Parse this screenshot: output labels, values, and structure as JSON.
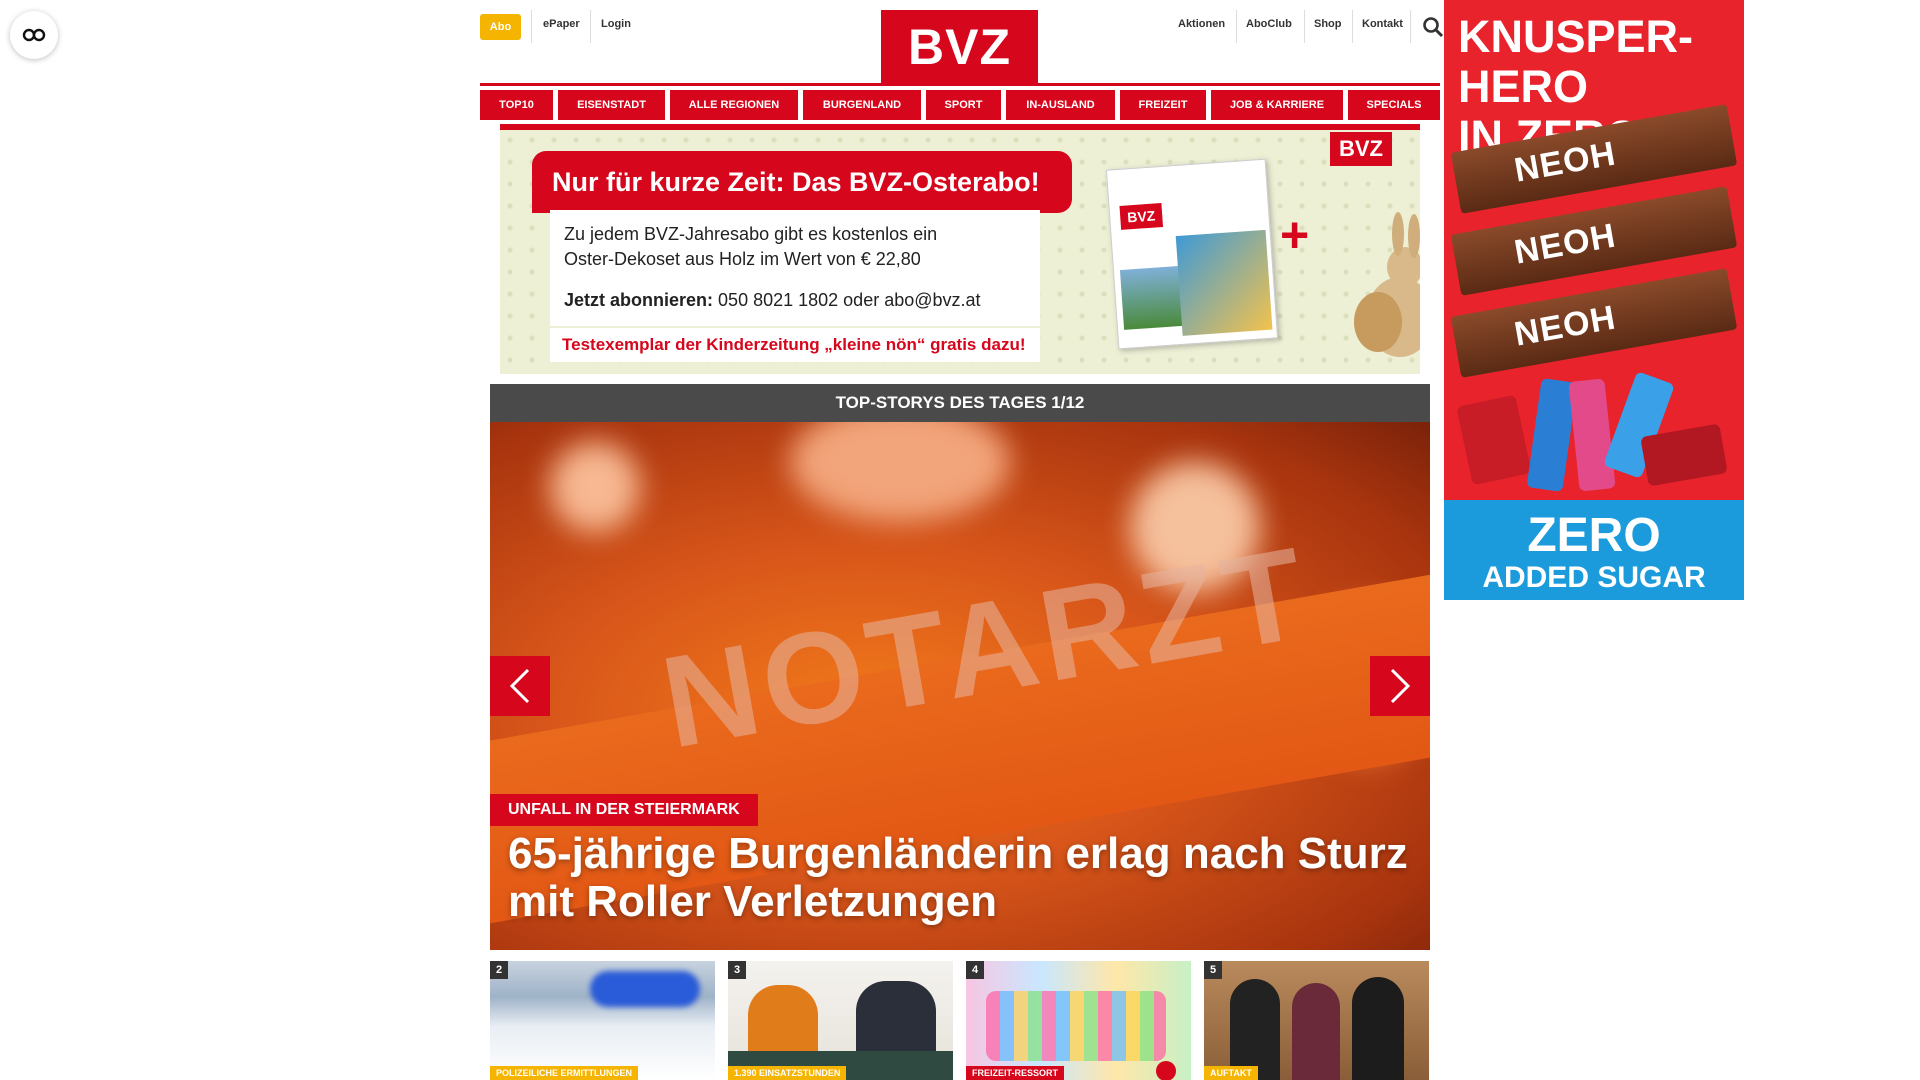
{
  "topbar": {
    "abo": "Abo",
    "epaper": "ePaper",
    "login": "Login",
    "aktionen": "Aktionen",
    "aboclub": "AboClub",
    "shop": "Shop",
    "kontakt": "Kontakt",
    "logo": "BVZ"
  },
  "nav": {
    "items": [
      "TOP10",
      "EISENSTADT",
      "ALLE REGIONEN",
      "BURGENLAND",
      "SPORT",
      "IN-AUSLAND",
      "FREIZEIT",
      "JOB & KARRIERE",
      "SPECIALS"
    ]
  },
  "promo": {
    "headline": "Nur für kurze Zeit: Das BVZ-Osterabo!",
    "line1": "Zu jedem BVZ-Jahresabo gibt es kostenlos ein",
    "line2": "Oster-Dekoset aus Holz im Wert von € 22,80",
    "subscribe_label": "Jetzt abonnieren:",
    "subscribe_contact": "050 8021 1802 oder abo@bvz.at",
    "testexemplar": "Testexemplar der Kinderzeitung „kleine nön“ gratis dazu!",
    "tag": "BVZ",
    "newspaper_logo": "BVZ"
  },
  "topstories": {
    "title": "TOP-STORYS DES TAGES 1/12",
    "hero": {
      "image_word": "NOTARZT",
      "kicker": "UNFALL IN DER STEIERMARK",
      "headline": "65-jährige Burgenländerin erlag nach Sturz mit Roller Verletzungen"
    },
    "thumbs": [
      {
        "num": "2",
        "tag": "POLIZEILICHE ERMITTLUNGEN"
      },
      {
        "num": "3",
        "tag": "1.390 EINSATZSTUNDEN"
      },
      {
        "num": "4",
        "tag": "FREIZEIT-RESSORT"
      },
      {
        "num": "5",
        "tag": "AUFTAKT"
      }
    ]
  },
  "ad": {
    "headline_1": "KNUSPER-HERO",
    "headline_2": "IN ZERO!",
    "brand": "NEOH",
    "zero": "ZERO",
    "sugar": "ADDED SUGAR"
  },
  "colors": {
    "brand_red": "#d6061c",
    "abo_yellow": "#f5b400",
    "section_grey": "#4a4a4a",
    "ad_blue": "#1c9bdc"
  }
}
